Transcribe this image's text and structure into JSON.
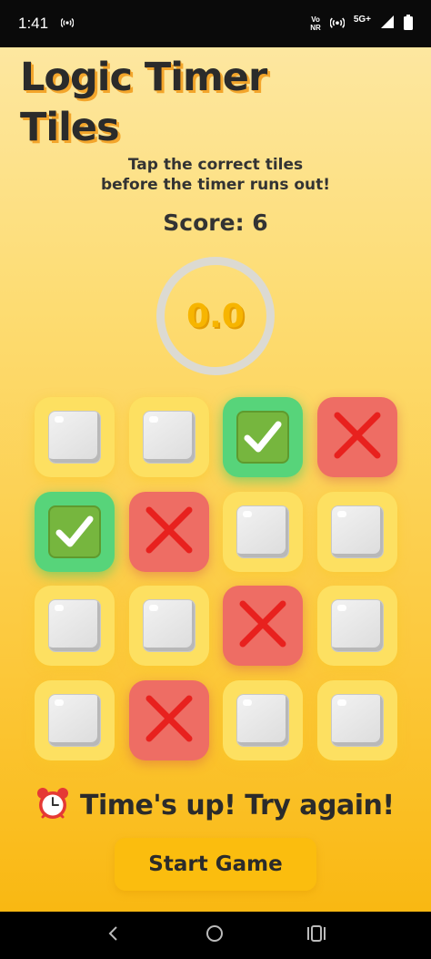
{
  "status_bar": {
    "time": "1:41",
    "network_label_top": "Vo",
    "network_label_bottom": "NR",
    "network_type": "5G+"
  },
  "app": {
    "title_line1": "Logic Timer",
    "title_line2": "Tiles",
    "instructions_line1": "Tap the correct tiles",
    "instructions_line2": "before the timer runs out!",
    "score_text": "Score: 6",
    "timer_value": "0.0",
    "status_message": "Time's up! Try again!",
    "status_icon": "alarm-clock-icon",
    "start_button_label": "Start Game"
  },
  "grid": {
    "rows": 4,
    "cols": 4,
    "tiles": [
      "empty",
      "empty",
      "correct",
      "wrong",
      "correct",
      "wrong",
      "empty",
      "empty",
      "empty",
      "empty",
      "wrong",
      "empty",
      "empty",
      "wrong",
      "empty",
      "empty"
    ]
  },
  "colors": {
    "background_top": "#fde7a0",
    "background_bottom": "#f9b812",
    "tile_empty": "#fde061",
    "tile_correct": "#57d47a",
    "tile_wrong": "#ee6d64",
    "timer_text": "#f7b500",
    "button": "#fbbd0e"
  }
}
